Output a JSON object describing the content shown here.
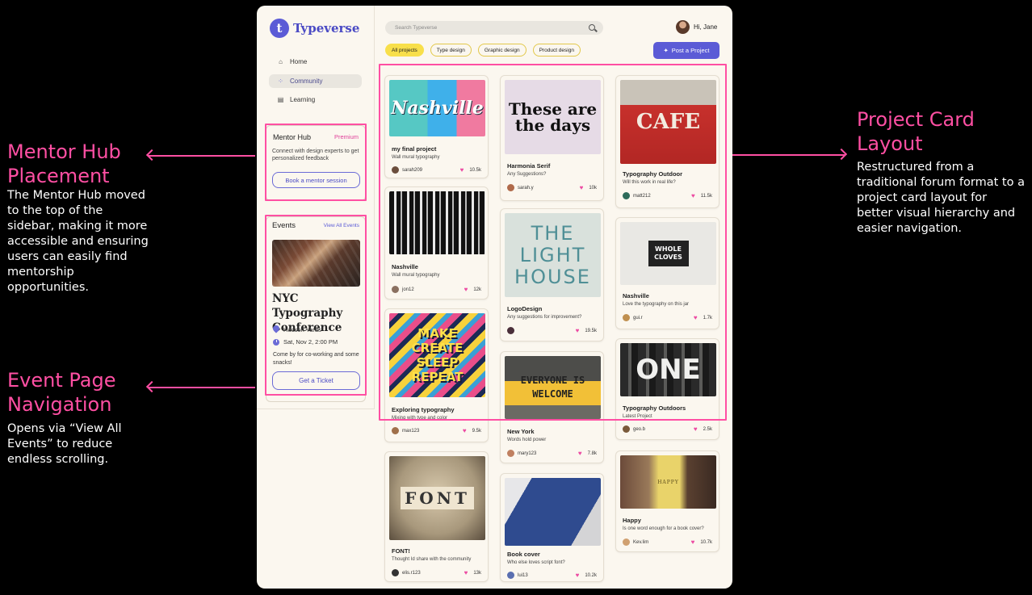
{
  "annotations": {
    "mentor": {
      "title": "Mentor Hub Placement",
      "desc": "The Mentor Hub moved to the top of the sidebar, making it more accessible and ensuring users can easily find mentorship opportunities."
    },
    "events": {
      "title": "Event Page Navigation",
      "desc": "Opens via “View All Events” to reduce endless scrolling."
    },
    "cards": {
      "title": "Project Card Layout",
      "desc": "Restructured from a traditional forum format to a project card layout for better visual hierarchy and easier navigation."
    }
  },
  "app": {
    "brand": "Typeverse",
    "logo_letter": "t",
    "nav": [
      {
        "label": "Home",
        "icon": "home-icon"
      },
      {
        "label": "Community",
        "icon": "community-icon"
      },
      {
        "label": "Learning",
        "icon": "book-icon"
      }
    ],
    "mentor": {
      "title": "Mentor Hub",
      "badge": "Premium",
      "desc": "Connect with design experts to get personalized feedback",
      "button": "Book a mentor session"
    },
    "events": {
      "title": "Events",
      "link": "View All Events",
      "name": "NYC Typography Conference",
      "location": "Hudson Yards",
      "date": "Sat, Nov 2, 2:00 PM",
      "desc": "Come by for co-working and some snacks!",
      "button": "Get a Ticket"
    },
    "search_placeholder": "Search Typeverse",
    "user_greeting": "Hi, Jane",
    "filters": [
      "All projects",
      "Type design",
      "Graphic design",
      "Product design"
    ],
    "post_button": "Post a Project",
    "cards": [
      {
        "title": "my final project",
        "sub": "Wall mural typography",
        "user": "sarah209",
        "likes": "10.5k",
        "img_text": "Nashville"
      },
      {
        "title": "Nashville",
        "sub": "Wall mural typography",
        "user": "jon12",
        "likes": "12k",
        "img_text": ""
      },
      {
        "title": "Exploring typography",
        "sub": "Mixing with type and color",
        "user": "max123",
        "likes": "9.5k",
        "img_text": "MAKE CREATE SLEEP REPEAT"
      },
      {
        "title": "FONT!",
        "sub": "Thought Id share with the community",
        "user": "elis.r123",
        "likes": "13k",
        "img_text": "FONT"
      },
      {
        "title": "Harmonia Serif",
        "sub": "Any Suggestions?",
        "user": "sarah.y",
        "likes": "10k",
        "img_text": "These are the days"
      },
      {
        "title": "LogoDesign",
        "sub": "Any suggestions for improvement?",
        "user": "",
        "likes": "19.5k",
        "img_text": "THE LIGHT HOUSE"
      },
      {
        "title": "New York",
        "sub": "Words hold power",
        "user": "mary123",
        "likes": "7.8k",
        "img_text": "EVERYONE IS WELCOME"
      },
      {
        "title": "Book cover",
        "sub": "Who else loves script font?",
        "user": "lui13",
        "likes": "10.2k",
        "img_text": ""
      },
      {
        "title": "Typography Outdoor",
        "sub": "Will this work in real life?",
        "user": "matt212",
        "likes": "11.5k",
        "img_text": "CAFE"
      },
      {
        "title": "Nashville",
        "sub": "Love the typography on this jar",
        "user": "gui.r",
        "likes": "1.7k",
        "img_text": "WHOLE CLOVES"
      },
      {
        "title": "Typography Outdoors",
        "sub": "Latest Project",
        "user": "geo.b",
        "likes": "2.5k",
        "img_text": "ONE"
      },
      {
        "title": "Happy",
        "sub": "Is one word enough for a book cover?",
        "user": "Kev.lim",
        "likes": "10.7k",
        "img_text": "HAPPY"
      }
    ]
  }
}
